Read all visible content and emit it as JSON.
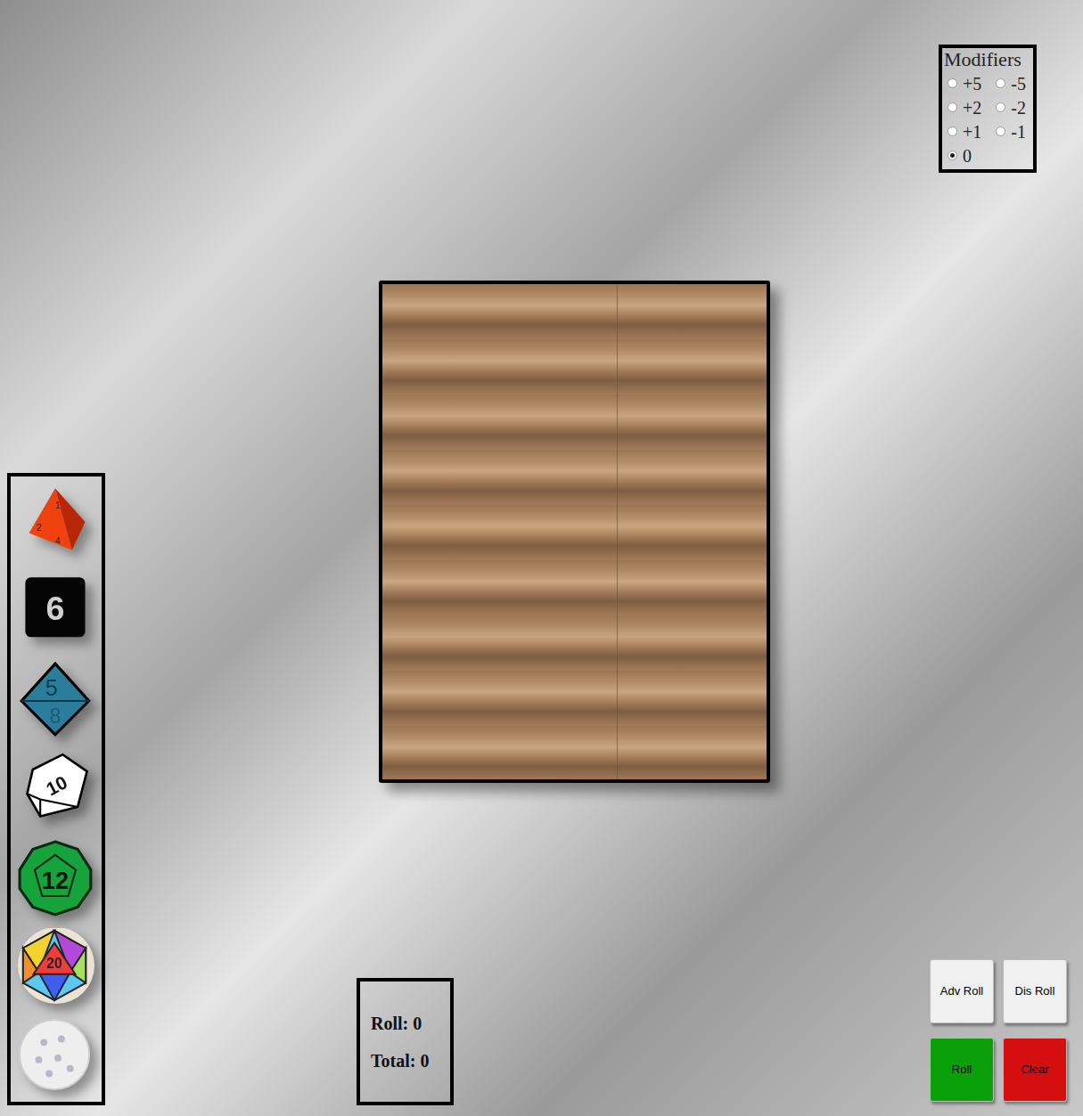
{
  "modifiers": {
    "title": "Modifiers",
    "options": [
      {
        "label": "+5",
        "selected": false
      },
      {
        "label": "-5",
        "selected": false
      },
      {
        "label": "+2",
        "selected": false
      },
      {
        "label": "-2",
        "selected": false
      },
      {
        "label": "+1",
        "selected": false
      },
      {
        "label": "-1",
        "selected": false
      },
      {
        "label": "0",
        "selected": true
      }
    ]
  },
  "dice": [
    {
      "kind": "d4",
      "labels": [
        "1",
        "2",
        "4"
      ],
      "color": "#f0420f"
    },
    {
      "kind": "d6",
      "labels": [
        "6"
      ],
      "color": "#050505"
    },
    {
      "kind": "d8",
      "labels": [
        "5",
        "8"
      ],
      "color": "#2b7d9c"
    },
    {
      "kind": "d10",
      "labels": [
        "10"
      ],
      "color": "#ffffff"
    },
    {
      "kind": "d12",
      "labels": [
        "12"
      ],
      "color": "#16a33c"
    },
    {
      "kind": "d20",
      "labels": [
        "20"
      ],
      "color": "#f03c3c"
    },
    {
      "kind": "d100",
      "labels": [],
      "color": "#eeeeee"
    }
  ],
  "result": {
    "roll": "Roll: 0",
    "total": "Total: 0"
  },
  "buttons": [
    {
      "label": "Adv Roll",
      "color": "#f0f0f0"
    },
    {
      "label": "Dis Roll",
      "color": "#f0f0f0"
    },
    {
      "label": "Roll",
      "color": "#0aa00a"
    },
    {
      "label": "Clear",
      "color": "#d50f0f"
    }
  ]
}
